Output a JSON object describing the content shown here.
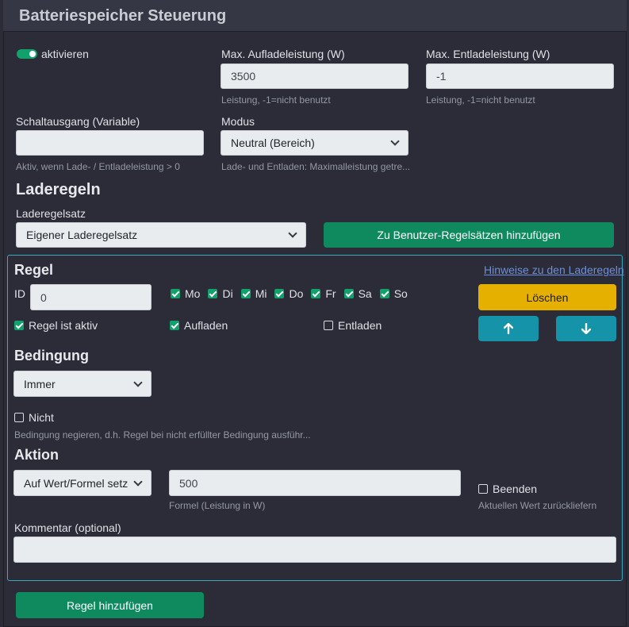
{
  "header": {
    "title": "Batteriespeicher Steuerung"
  },
  "activate": {
    "label": "aktivieren"
  },
  "max_charge": {
    "label": "Max. Aufladeleistung (W)",
    "value": "3500",
    "help": "Leistung, -1=nicht benutzt"
  },
  "max_discharge": {
    "label": "Max. Entladeleistung (W)",
    "value": "-1",
    "help": "Leistung, -1=nicht benutzt"
  },
  "switch_output": {
    "label": "Schaltausgang (Variable)",
    "value": "",
    "help": "Aktiv, wenn Lade- / Entladeleistung > 0"
  },
  "mode": {
    "label": "Modus",
    "selected": "Neutral (Bereich)",
    "help": "Lade- und Entladen: Maximalleistung getre..."
  },
  "rules_section": {
    "title": "Laderegeln",
    "ruleset_label": "Laderegelsatz",
    "ruleset_selected": "Eigener Laderegelsatz",
    "add_to_user_button": "Zu Benutzer-Regelsätzen hinzufügen"
  },
  "rule": {
    "title": "Regel",
    "hints_link": "Hinweise zu den Laderegeln",
    "id_label": "ID",
    "id_value": "0",
    "days": [
      {
        "label": "Mo",
        "checked": true
      },
      {
        "label": "Di",
        "checked": true
      },
      {
        "label": "Mi",
        "checked": true
      },
      {
        "label": "Do",
        "checked": true
      },
      {
        "label": "Fr",
        "checked": true
      },
      {
        "label": "Sa",
        "checked": true
      },
      {
        "label": "So",
        "checked": true
      }
    ],
    "delete_button": "Löschen",
    "active_label": "Regel ist aktiv",
    "charge_label": "Aufladen",
    "discharge_label": "Entladen",
    "condition": {
      "title": "Bedingung",
      "selected": "Immer",
      "not_label": "Nicht",
      "help": "Bedingung negieren, d.h. Regel bei nicht erfüllter Bedingung ausführ..."
    },
    "action": {
      "title": "Aktion",
      "selected": "Auf Wert/Formel setzen",
      "formula_value": "500",
      "formula_help": "Formel (Leistung in W)",
      "end_label": "Beenden",
      "end_help": "Aktuellen Wert zurückliefern"
    },
    "comment": {
      "label": "Kommentar (optional)",
      "value": ""
    }
  },
  "add_rule_button": "Regel hinzufügen",
  "colors": {
    "background": "#2b2c37",
    "accent_green": "#0f8a5f",
    "accent_yellow": "#e6b000",
    "accent_teal": "#1593a8",
    "rule_border": "#3aa9bd"
  }
}
